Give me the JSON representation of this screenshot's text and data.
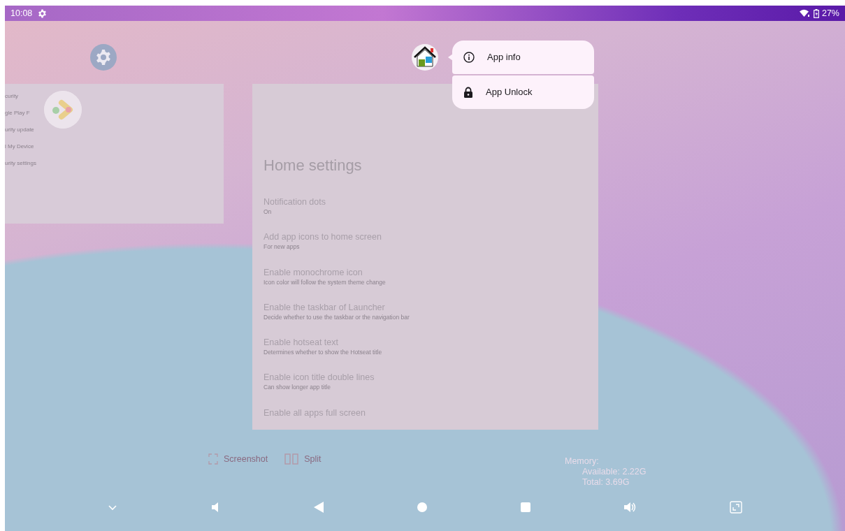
{
  "status_bar": {
    "time": "10:08",
    "battery": "27%"
  },
  "left_task": {
    "lines": [
      "curity",
      "gle Play F",
      "urity update",
      "l My Device",
      "urity settings"
    ]
  },
  "home_settings_task": {
    "title": "Home settings",
    "items": [
      {
        "title": "Notification dots",
        "subtitle": "On"
      },
      {
        "title": "Add app icons to home screen",
        "subtitle": "For new apps"
      },
      {
        "title": "Enable monochrome icon",
        "subtitle": "Icon color will follow the system theme change"
      },
      {
        "title": "Enable the taskbar of Launcher",
        "subtitle": "Decide whether to use the taskbar or the navigation bar"
      },
      {
        "title": "Enable hotseat text",
        "subtitle": "Determines whether to show the Hotseat title"
      },
      {
        "title": "Enable icon title double lines",
        "subtitle": "Can show longer app title"
      },
      {
        "title": "Enable all apps full screen"
      }
    ]
  },
  "popup_menu": {
    "items": [
      {
        "kind": "info",
        "label": "App info"
      },
      {
        "kind": "lock",
        "label": "App Unlock"
      }
    ]
  },
  "actions": [
    {
      "kind": "screenshot",
      "label": "Screenshot"
    },
    {
      "kind": "split",
      "label": "Split"
    }
  ],
  "memory": {
    "heading": "Memory:",
    "available": "Available: 2.22G",
    "total": "Total: 3.69G"
  }
}
